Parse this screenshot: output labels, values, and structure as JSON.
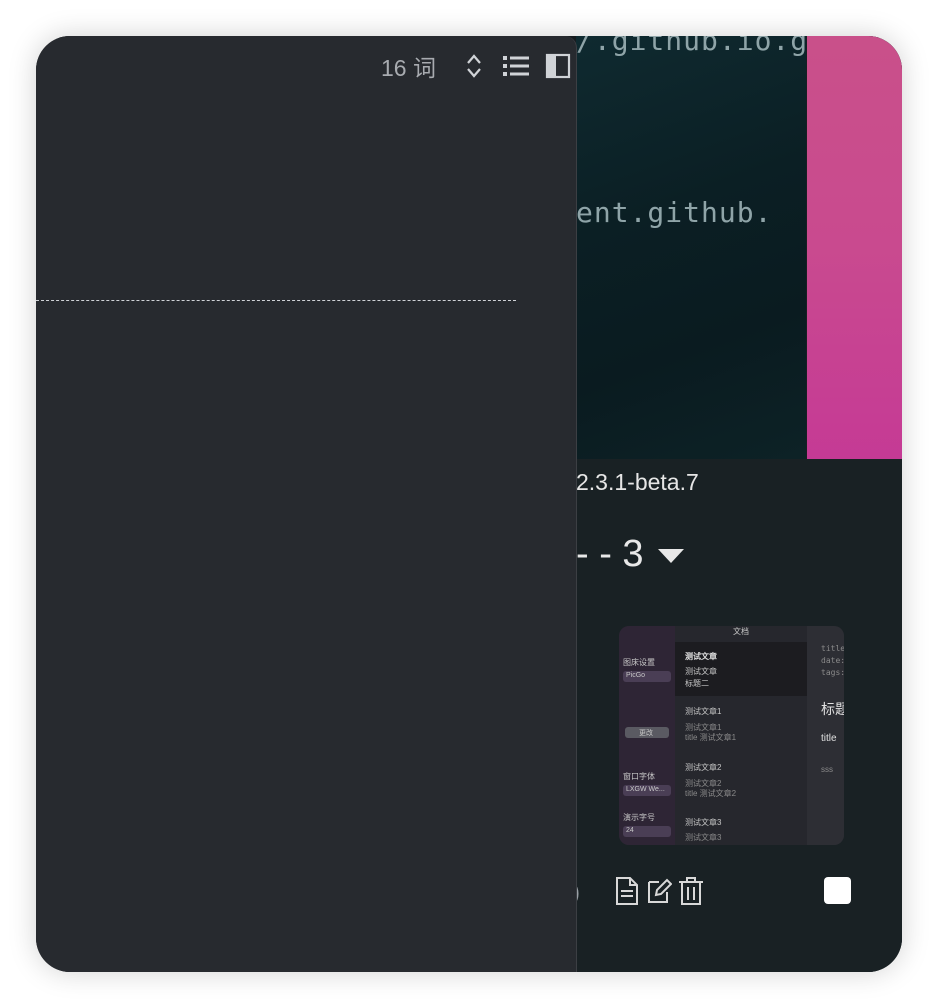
{
  "background_app": {
    "code_line_1": "/.github.io.g",
    "code_line_2": "ent.github.",
    "version": "2.3.1-beta.7",
    "dropdown_text": "- - 3",
    "thumbnail": {
      "sidebar_label_1": "图床设置",
      "sidebar_select_1": "PicGo",
      "sidebar_button": "更改",
      "sidebar_label_2": "窗口字体",
      "sidebar_select_2": "LXGW We...",
      "sidebar_label_3": "演示字号",
      "sidebar_select_3": "24",
      "list_header": "文档",
      "items": [
        {
          "title": "测试文章",
          "sub1": "测试文章",
          "sub2": "标题二"
        },
        {
          "title": "测试文章1",
          "sub1": "测试文章1",
          "sub2": "title 测试文章1"
        },
        {
          "title": "测试文章2",
          "sub1": "测试文章2",
          "sub2": "title 测试文章2"
        },
        {
          "title": "测试文章3",
          "sub1": "测试文章3",
          "sub2": ""
        }
      ],
      "preview_meta_1": "title",
      "preview_meta_2": "date:",
      "preview_meta_3": "tags:",
      "preview_heading": "标题",
      "preview_sub": "title",
      "preview_body": "sss"
    },
    "colors": {
      "accent_pink": "#c94a8f",
      "checkbox": "#ffffff"
    }
  },
  "editor": {
    "word_count": "16 词",
    "icons": [
      "sort-toggle-icon",
      "outline-list-icon",
      "sidebar-toggle-icon"
    ]
  }
}
